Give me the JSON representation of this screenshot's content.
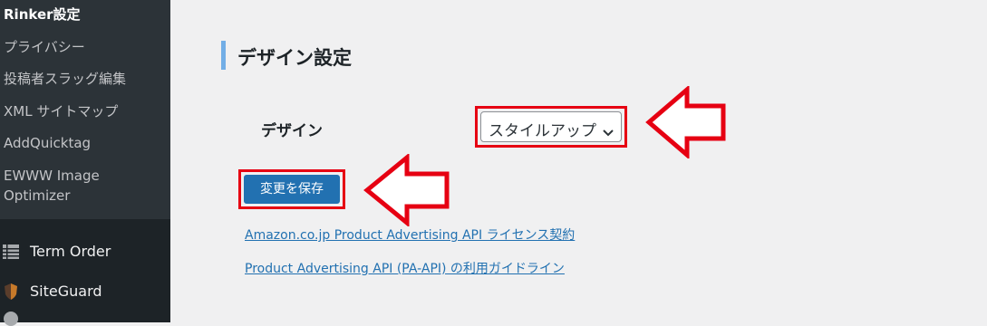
{
  "sidebar": {
    "submenu": [
      {
        "label": "Rinker設定",
        "current": true
      },
      {
        "label": "プライバシー",
        "current": false
      },
      {
        "label": "投稿者スラッグ編集",
        "current": false
      },
      {
        "label": "XML サイトマップ",
        "current": false
      },
      {
        "label": "AddQuicktag",
        "current": false
      },
      {
        "label": "EWWW Image",
        "current": false
      },
      {
        "label": "Optimizer",
        "current": false
      }
    ],
    "menu": [
      {
        "label": "Term Order",
        "icon": "list-icon"
      },
      {
        "label": "SiteGuard",
        "icon": "shield-icon"
      }
    ]
  },
  "main": {
    "section_title": "デザイン設定",
    "design_label": "デザイン",
    "design_select": {
      "selected": "スタイルアップ"
    },
    "save_button": "変更を保存",
    "links": [
      "Amazon.co.jp Product Advertising API ライセンス契約",
      "Product Advertising API (PA-API) の利用ガイドライン"
    ]
  },
  "colors": {
    "sidebar_bg": "#1d2327",
    "submenu_bg": "#2c3338",
    "accent_bar": "#72aee6",
    "primary_button": "#2271b1",
    "link": "#2271b1",
    "annotation_red": "#e60012"
  }
}
